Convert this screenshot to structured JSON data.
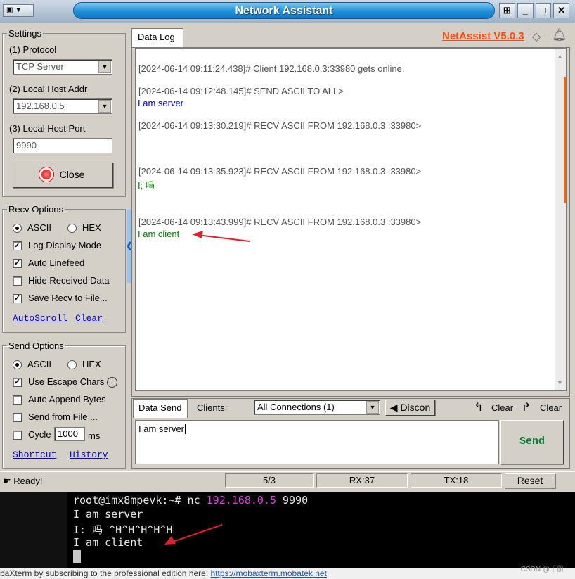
{
  "window": {
    "title": "Network Assistant",
    "sysmenu": "▼",
    "buttons": [
      "⊞",
      "_",
      "□",
      "✕"
    ]
  },
  "settings": {
    "legend": "Settings",
    "protocol_label": "(1) Protocol",
    "protocol_value": "TCP Server",
    "host_label": "(2) Local Host Addr",
    "host_value": "192.168.0.5",
    "port_label": "(3) Local Host Port",
    "port_value": "9990",
    "close_button": "Close"
  },
  "recv": {
    "legend": "Recv Options",
    "ascii": "ASCII",
    "hex": "HEX",
    "log_display": "Log Display Mode",
    "auto_linefeed": "Auto Linefeed",
    "hide_received": "Hide Received Data",
    "save_recv": "Save Recv to File...",
    "autoscroll": "AutoScroll",
    "clear": "Clear"
  },
  "send_opts": {
    "legend": "Send Options",
    "ascii": "ASCII",
    "hex": "HEX",
    "escape": "Use Escape Chars",
    "append": "Auto Append Bytes",
    "from_file": "Send from File ...",
    "cycle": "Cycle",
    "cycle_value": "1000",
    "cycle_unit": "ms",
    "shortcut": "Shortcut",
    "history": "History"
  },
  "datalog": {
    "tab": "Data Log",
    "brand": "NetAssist V5.0.3",
    "entries": [
      {
        "header": "[2024-06-14 09:11:24.438]# Client 192.168.0.3:33980 gets online.",
        "body": ""
      },
      {
        "header": "[2024-06-14 09:12:48.145]# SEND ASCII TO ALL>",
        "body": "I am server"
      },
      {
        "header": "[2024-06-14 09:13:30.219]# RECV ASCII FROM 192.168.0.3 :33980>",
        "body": ""
      },
      {
        "header": "[2024-06-14 09:13:35.923]# RECV ASCII FROM 192.168.0.3 :33980>",
        "body": "I; 吗"
      },
      {
        "header": "[2024-06-14 09:13:43.999]# RECV ASCII FROM 192.168.0.3 :33980>",
        "body": "I am client"
      }
    ]
  },
  "datasend": {
    "tab": "Data Send",
    "clients_label": "Clients:",
    "clients_value": "All Connections (1)",
    "disconnect": "Discon",
    "clear1": "Clear",
    "clear2": "Clear",
    "input_value": "I am server",
    "send_button": "Send"
  },
  "status": {
    "ready": "Ready!",
    "ratio": "5/3",
    "rx": "RX:37",
    "tx": "TX:18",
    "reset": "Reset"
  },
  "terminal": {
    "prompt": "root@imx8mpevk:~# nc ",
    "ip": "192.168.0.5",
    "port": " 9990",
    "lines": [
      "I am server",
      "I: 吗 ^H^H^H^H^H",
      "I am client"
    ]
  },
  "mobaxterm_footer": {
    "text": "baXterm by subscribing to the professional edition here: ",
    "link": "https://mobaxterm.mobatek.net"
  },
  "watermark": "CSDN @千册",
  "colors": {
    "brand": "#ff4a0a",
    "send_text": "#0000ff",
    "recv_text": "#008000",
    "send_button": "#0a7a3a",
    "ip_highlight": "#e040e0",
    "arrow": "#e0202a"
  }
}
